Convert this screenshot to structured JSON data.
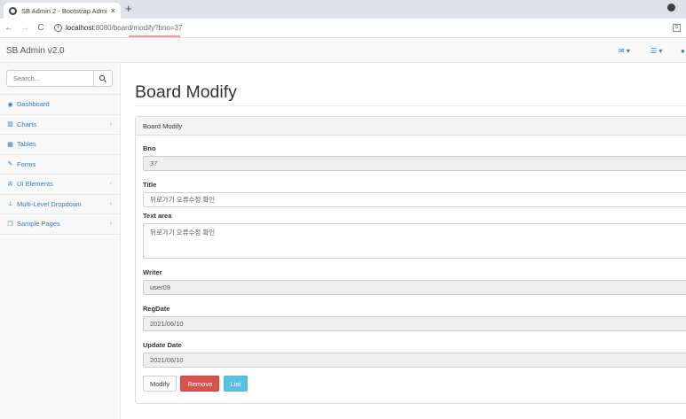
{
  "browser": {
    "tab_title": "SB Admin 2 - Bootstrap Admin",
    "tab_close": "×",
    "new_tab": "+",
    "url_host": "localhost",
    "url_rest": ":8080/board/modify?bno=37",
    "back": "←",
    "forward": "→",
    "reload": "C",
    "info": "i"
  },
  "navbar": {
    "brand": "SB Admin v2.0",
    "icons": [
      "envelope-icon",
      "tasks-icon",
      "bell-icon"
    ]
  },
  "sidebar": {
    "search_placeholder": "Search...",
    "items": [
      {
        "label": "Dashboard",
        "icon": "dashboard-icon",
        "glyph": "◉",
        "has_arrow": false
      },
      {
        "label": "Charts",
        "icon": "bar-chart-icon",
        "glyph": "▥",
        "has_arrow": true
      },
      {
        "label": "Tables",
        "icon": "table-icon",
        "glyph": "▦",
        "has_arrow": false
      },
      {
        "label": "Forms",
        "icon": "edit-icon",
        "glyph": "✎",
        "has_arrow": false
      },
      {
        "label": "UI Elements",
        "icon": "wrench-icon",
        "glyph": "✇",
        "has_arrow": true
      },
      {
        "label": "Multi-Level Dropdown",
        "icon": "sitemap-icon",
        "glyph": "⊥",
        "has_arrow": true
      },
      {
        "label": "Sample Pages",
        "icon": "files-icon",
        "glyph": "❐",
        "has_arrow": true
      }
    ],
    "arrow": "‹"
  },
  "main": {
    "title": "Board Modify",
    "panel_heading": "Board Modify",
    "fields": {
      "bno_label": "Bno",
      "bno_value": "37",
      "title_label": "Title",
      "title_value": "뒤로가기 오류수정 확인",
      "content_label": "Text area",
      "content_value": "뒤로가기 오류수정 확인",
      "writer_label": "Writer",
      "writer_value": "user09",
      "regdate_label": "RegDate",
      "regdate_value": "2021/06/10",
      "updatedate_label": "Update Date",
      "updatedate_value": "2021/06/10"
    },
    "buttons": {
      "modify": "Modify",
      "remove": "Remove",
      "list": "List"
    }
  },
  "colors": {
    "link": "#337ab7",
    "danger": "#d9534f",
    "info": "#5bc0de"
  }
}
